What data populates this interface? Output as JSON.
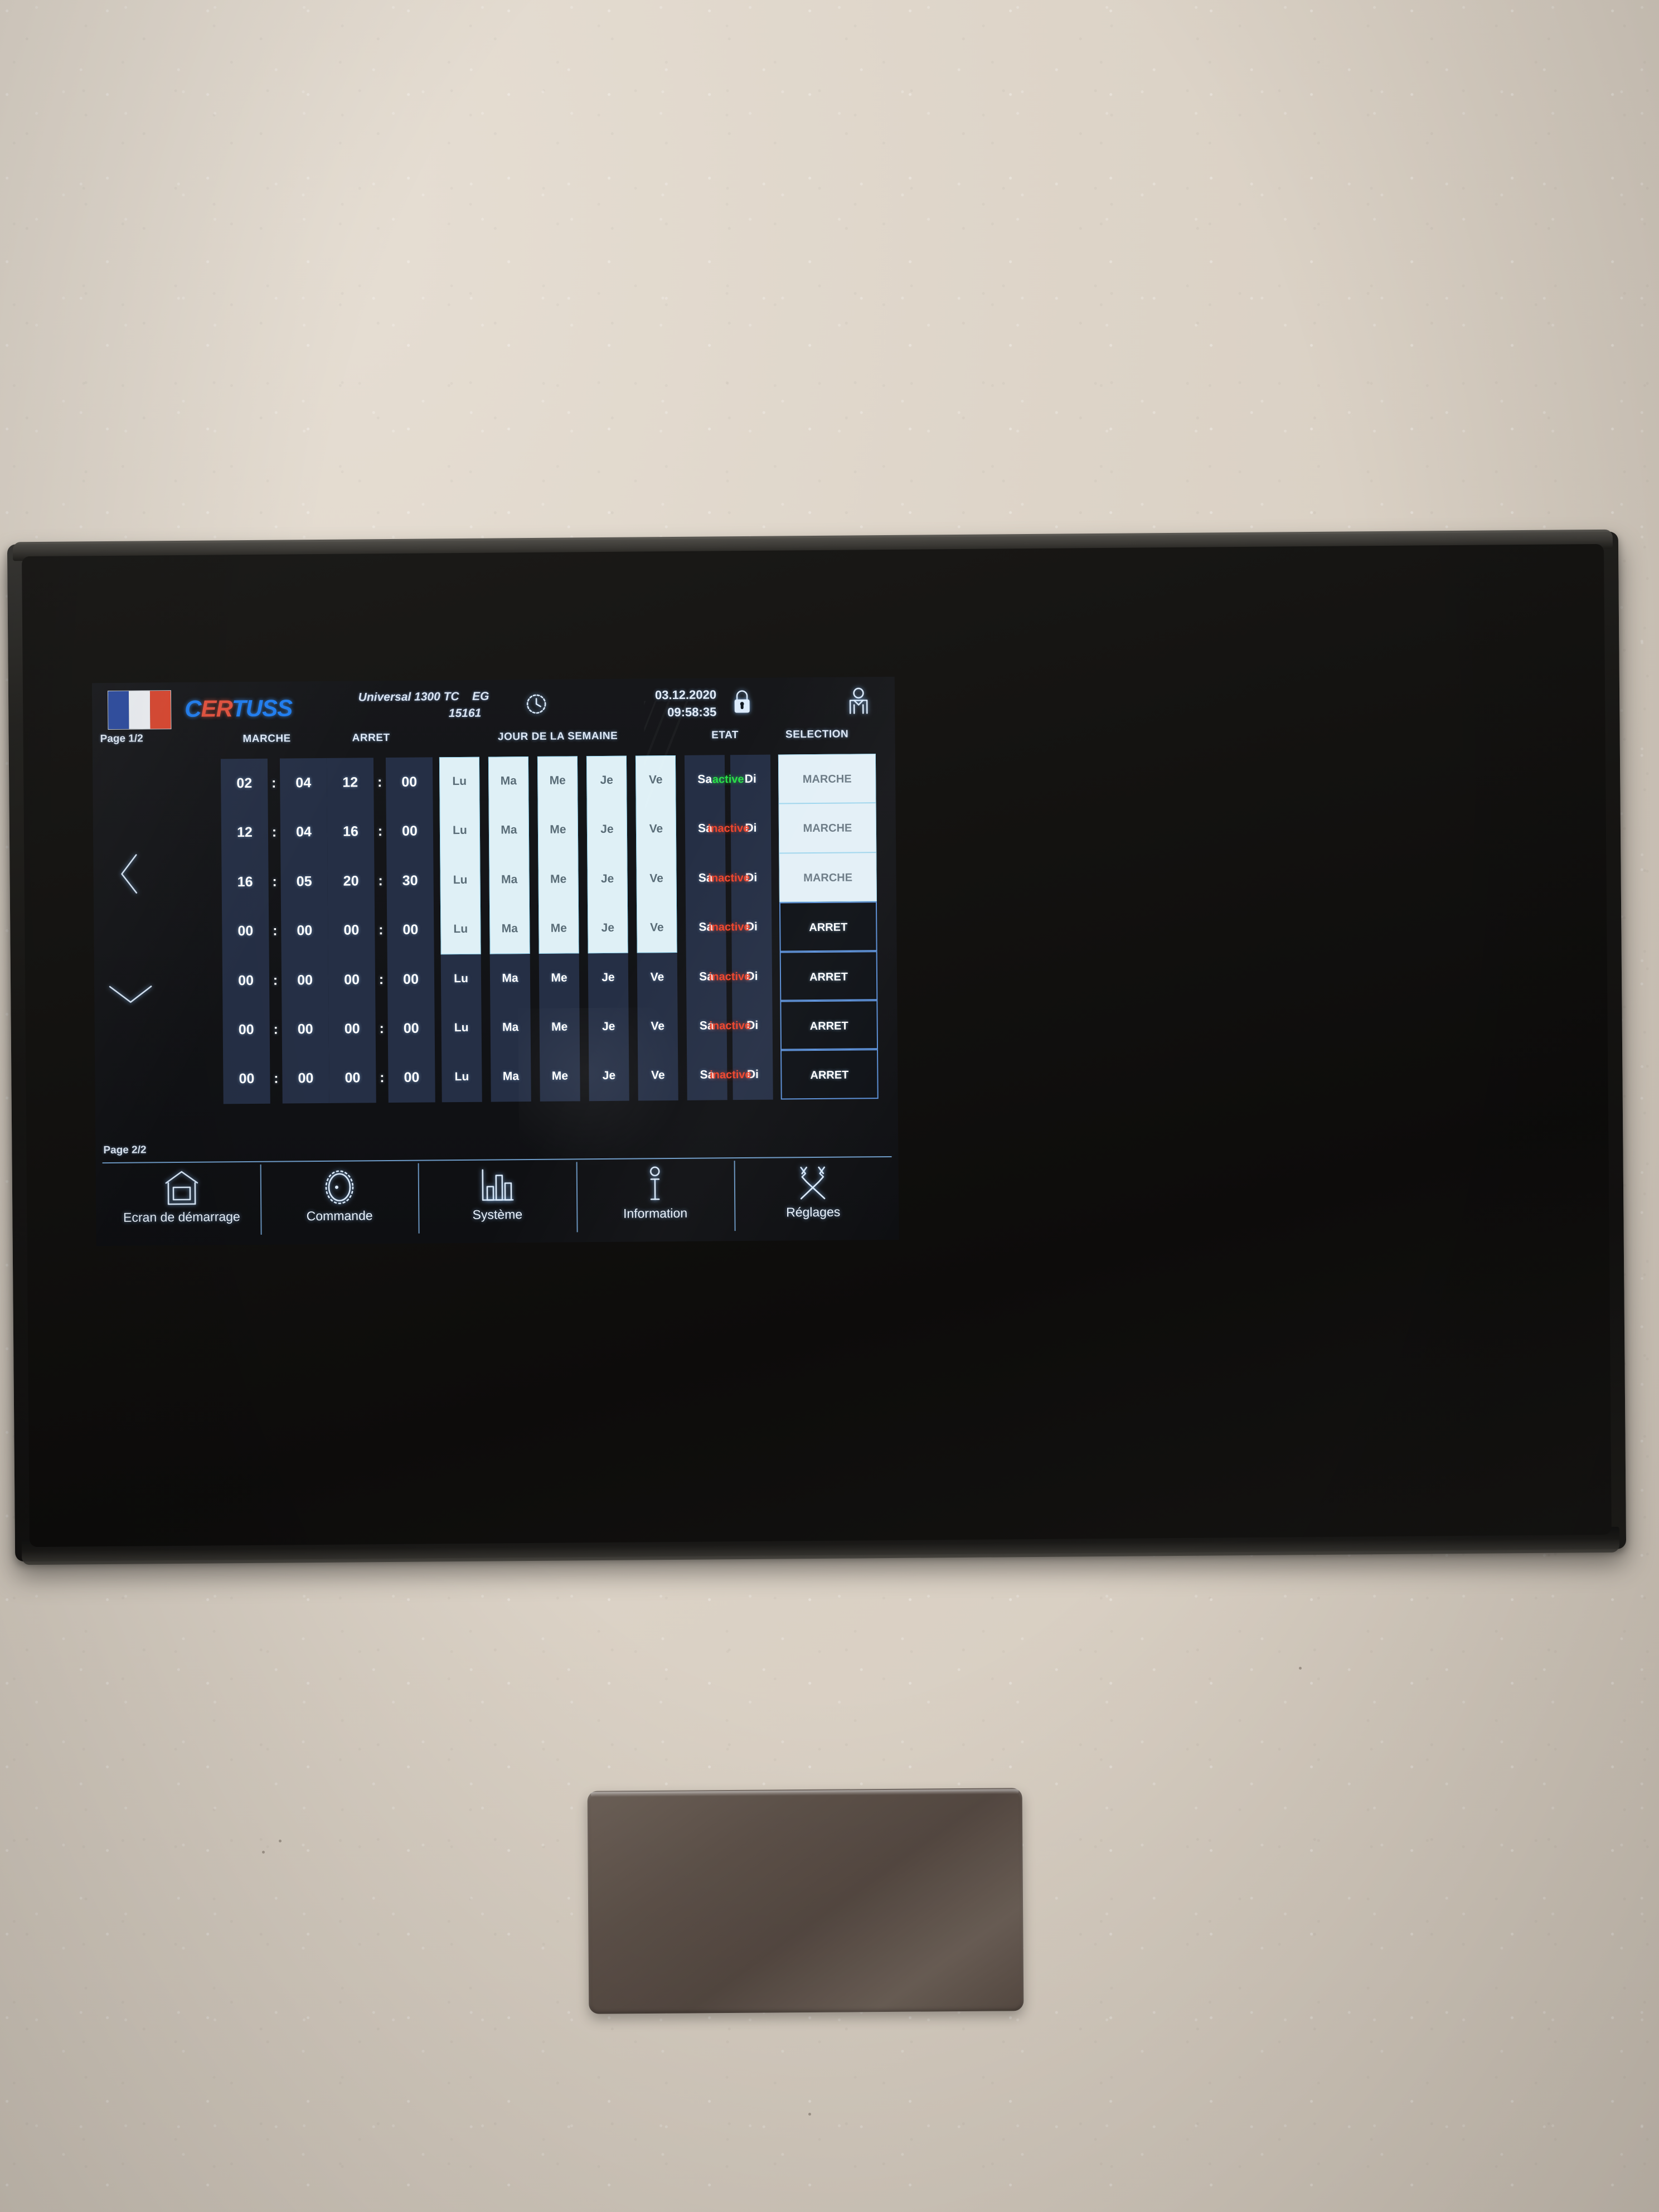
{
  "header": {
    "flag": "french-flag",
    "brand": "CERTUSS",
    "brand_prefix": "C",
    "brand_mid": "ER",
    "brand_suffix": "TUSS",
    "model": "Universal 1300 TC",
    "model_suffix": "EG",
    "serial": "15161",
    "date": "03.12.2020",
    "time": "09:58:35",
    "clock_icon": "clock-icon",
    "lock_icon": "lock-closed-icon",
    "user_icon": "user-icon"
  },
  "rail": {
    "page_top": "Page 1/2",
    "page_bottom": "Page 2/2",
    "back_icon": "chevron-left-icon",
    "down_icon": "chevron-down-icon"
  },
  "columns": {
    "marche": "MARCHE",
    "arret": "ARRET",
    "jour": "JOUR DE LA SEMAINE",
    "etat": "ETAT",
    "selection": "SELECTION"
  },
  "days": [
    "Lu",
    "Ma",
    "Me",
    "Je",
    "Ve",
    "Sa",
    "Di"
  ],
  "colors": {
    "active": "#2ae04a",
    "inactive": "#f0452c",
    "selected_cell": "#dff0f6",
    "unselected_cell": "#252f45",
    "accent": "#7fb4e8"
  },
  "rows": [
    {
      "on_h": "02",
      "on_m": "04",
      "off_h": "12",
      "off_m": "00",
      "days_on": [
        true,
        true,
        true,
        true,
        true,
        false,
        false
      ],
      "etat": "active",
      "etat_state": "active",
      "selection": "MARCHE",
      "selection_state": "on"
    },
    {
      "on_h": "12",
      "on_m": "04",
      "off_h": "16",
      "off_m": "00",
      "days_on": [
        true,
        true,
        true,
        true,
        true,
        false,
        false
      ],
      "etat": "inactive",
      "etat_state": "inactive",
      "selection": "MARCHE",
      "selection_state": "on"
    },
    {
      "on_h": "16",
      "on_m": "05",
      "off_h": "20",
      "off_m": "30",
      "days_on": [
        true,
        true,
        true,
        true,
        true,
        false,
        false
      ],
      "etat": "inactive",
      "etat_state": "inactive",
      "selection": "MARCHE",
      "selection_state": "on"
    },
    {
      "on_h": "00",
      "on_m": "00",
      "off_h": "00",
      "off_m": "00",
      "days_on": [
        true,
        true,
        true,
        true,
        true,
        false,
        false
      ],
      "etat": "inactive",
      "etat_state": "inactive",
      "selection": "ARRET",
      "selection_state": "off"
    },
    {
      "on_h": "00",
      "on_m": "00",
      "off_h": "00",
      "off_m": "00",
      "days_on": [
        false,
        false,
        false,
        false,
        false,
        false,
        false
      ],
      "etat": "inactive",
      "etat_state": "inactive",
      "selection": "ARRET",
      "selection_state": "off"
    },
    {
      "on_h": "00",
      "on_m": "00",
      "off_h": "00",
      "off_m": "00",
      "days_on": [
        false,
        false,
        false,
        false,
        false,
        false,
        false
      ],
      "etat": "inactive",
      "etat_state": "inactive",
      "selection": "ARRET",
      "selection_state": "off"
    },
    {
      "on_h": "00",
      "on_m": "00",
      "off_h": "00",
      "off_m": "00",
      "days_on": [
        false,
        false,
        false,
        false,
        false,
        false,
        false
      ],
      "etat": "inactive",
      "etat_state": "inactive",
      "selection": "ARRET",
      "selection_state": "off"
    }
  ],
  "nav": [
    {
      "label": "Ecran de démarrage",
      "icon": "home-icon"
    },
    {
      "label": "Commande",
      "icon": "gear-knob-icon"
    },
    {
      "label": "Système",
      "icon": "bar-chart-icon"
    },
    {
      "label": "Information",
      "icon": "info-icon"
    },
    {
      "label": "Réglages",
      "icon": "tools-icon"
    }
  ]
}
